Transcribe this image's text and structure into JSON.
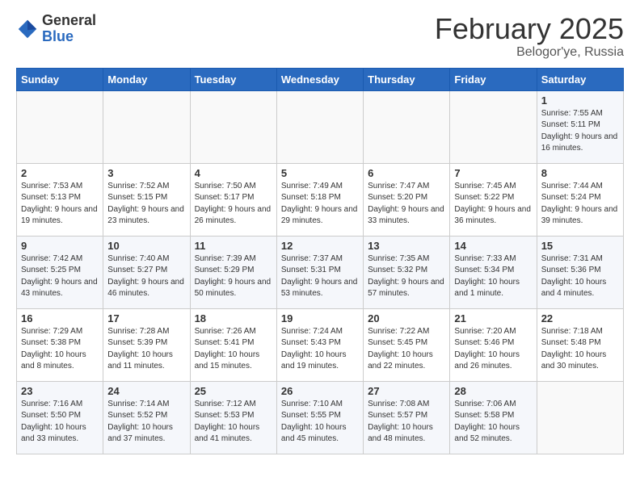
{
  "header": {
    "logo_general": "General",
    "logo_blue": "Blue",
    "title": "February 2025",
    "subtitle": "Belogor'ye, Russia"
  },
  "weekdays": [
    "Sunday",
    "Monday",
    "Tuesday",
    "Wednesday",
    "Thursday",
    "Friday",
    "Saturday"
  ],
  "weeks": [
    [
      {
        "day": "",
        "info": ""
      },
      {
        "day": "",
        "info": ""
      },
      {
        "day": "",
        "info": ""
      },
      {
        "day": "",
        "info": ""
      },
      {
        "day": "",
        "info": ""
      },
      {
        "day": "",
        "info": ""
      },
      {
        "day": "1",
        "info": "Sunrise: 7:55 AM\nSunset: 5:11 PM\nDaylight: 9 hours and 16 minutes."
      }
    ],
    [
      {
        "day": "2",
        "info": "Sunrise: 7:53 AM\nSunset: 5:13 PM\nDaylight: 9 hours and 19 minutes."
      },
      {
        "day": "3",
        "info": "Sunrise: 7:52 AM\nSunset: 5:15 PM\nDaylight: 9 hours and 23 minutes."
      },
      {
        "day": "4",
        "info": "Sunrise: 7:50 AM\nSunset: 5:17 PM\nDaylight: 9 hours and 26 minutes."
      },
      {
        "day": "5",
        "info": "Sunrise: 7:49 AM\nSunset: 5:18 PM\nDaylight: 9 hours and 29 minutes."
      },
      {
        "day": "6",
        "info": "Sunrise: 7:47 AM\nSunset: 5:20 PM\nDaylight: 9 hours and 33 minutes."
      },
      {
        "day": "7",
        "info": "Sunrise: 7:45 AM\nSunset: 5:22 PM\nDaylight: 9 hours and 36 minutes."
      },
      {
        "day": "8",
        "info": "Sunrise: 7:44 AM\nSunset: 5:24 PM\nDaylight: 9 hours and 39 minutes."
      }
    ],
    [
      {
        "day": "9",
        "info": "Sunrise: 7:42 AM\nSunset: 5:25 PM\nDaylight: 9 hours and 43 minutes."
      },
      {
        "day": "10",
        "info": "Sunrise: 7:40 AM\nSunset: 5:27 PM\nDaylight: 9 hours and 46 minutes."
      },
      {
        "day": "11",
        "info": "Sunrise: 7:39 AM\nSunset: 5:29 PM\nDaylight: 9 hours and 50 minutes."
      },
      {
        "day": "12",
        "info": "Sunrise: 7:37 AM\nSunset: 5:31 PM\nDaylight: 9 hours and 53 minutes."
      },
      {
        "day": "13",
        "info": "Sunrise: 7:35 AM\nSunset: 5:32 PM\nDaylight: 9 hours and 57 minutes."
      },
      {
        "day": "14",
        "info": "Sunrise: 7:33 AM\nSunset: 5:34 PM\nDaylight: 10 hours and 1 minute."
      },
      {
        "day": "15",
        "info": "Sunrise: 7:31 AM\nSunset: 5:36 PM\nDaylight: 10 hours and 4 minutes."
      }
    ],
    [
      {
        "day": "16",
        "info": "Sunrise: 7:29 AM\nSunset: 5:38 PM\nDaylight: 10 hours and 8 minutes."
      },
      {
        "day": "17",
        "info": "Sunrise: 7:28 AM\nSunset: 5:39 PM\nDaylight: 10 hours and 11 minutes."
      },
      {
        "day": "18",
        "info": "Sunrise: 7:26 AM\nSunset: 5:41 PM\nDaylight: 10 hours and 15 minutes."
      },
      {
        "day": "19",
        "info": "Sunrise: 7:24 AM\nSunset: 5:43 PM\nDaylight: 10 hours and 19 minutes."
      },
      {
        "day": "20",
        "info": "Sunrise: 7:22 AM\nSunset: 5:45 PM\nDaylight: 10 hours and 22 minutes."
      },
      {
        "day": "21",
        "info": "Sunrise: 7:20 AM\nSunset: 5:46 PM\nDaylight: 10 hours and 26 minutes."
      },
      {
        "day": "22",
        "info": "Sunrise: 7:18 AM\nSunset: 5:48 PM\nDaylight: 10 hours and 30 minutes."
      }
    ],
    [
      {
        "day": "23",
        "info": "Sunrise: 7:16 AM\nSunset: 5:50 PM\nDaylight: 10 hours and 33 minutes."
      },
      {
        "day": "24",
        "info": "Sunrise: 7:14 AM\nSunset: 5:52 PM\nDaylight: 10 hours and 37 minutes."
      },
      {
        "day": "25",
        "info": "Sunrise: 7:12 AM\nSunset: 5:53 PM\nDaylight: 10 hours and 41 minutes."
      },
      {
        "day": "26",
        "info": "Sunrise: 7:10 AM\nSunset: 5:55 PM\nDaylight: 10 hours and 45 minutes."
      },
      {
        "day": "27",
        "info": "Sunrise: 7:08 AM\nSunset: 5:57 PM\nDaylight: 10 hours and 48 minutes."
      },
      {
        "day": "28",
        "info": "Sunrise: 7:06 AM\nSunset: 5:58 PM\nDaylight: 10 hours and 52 minutes."
      },
      {
        "day": "",
        "info": ""
      }
    ]
  ]
}
